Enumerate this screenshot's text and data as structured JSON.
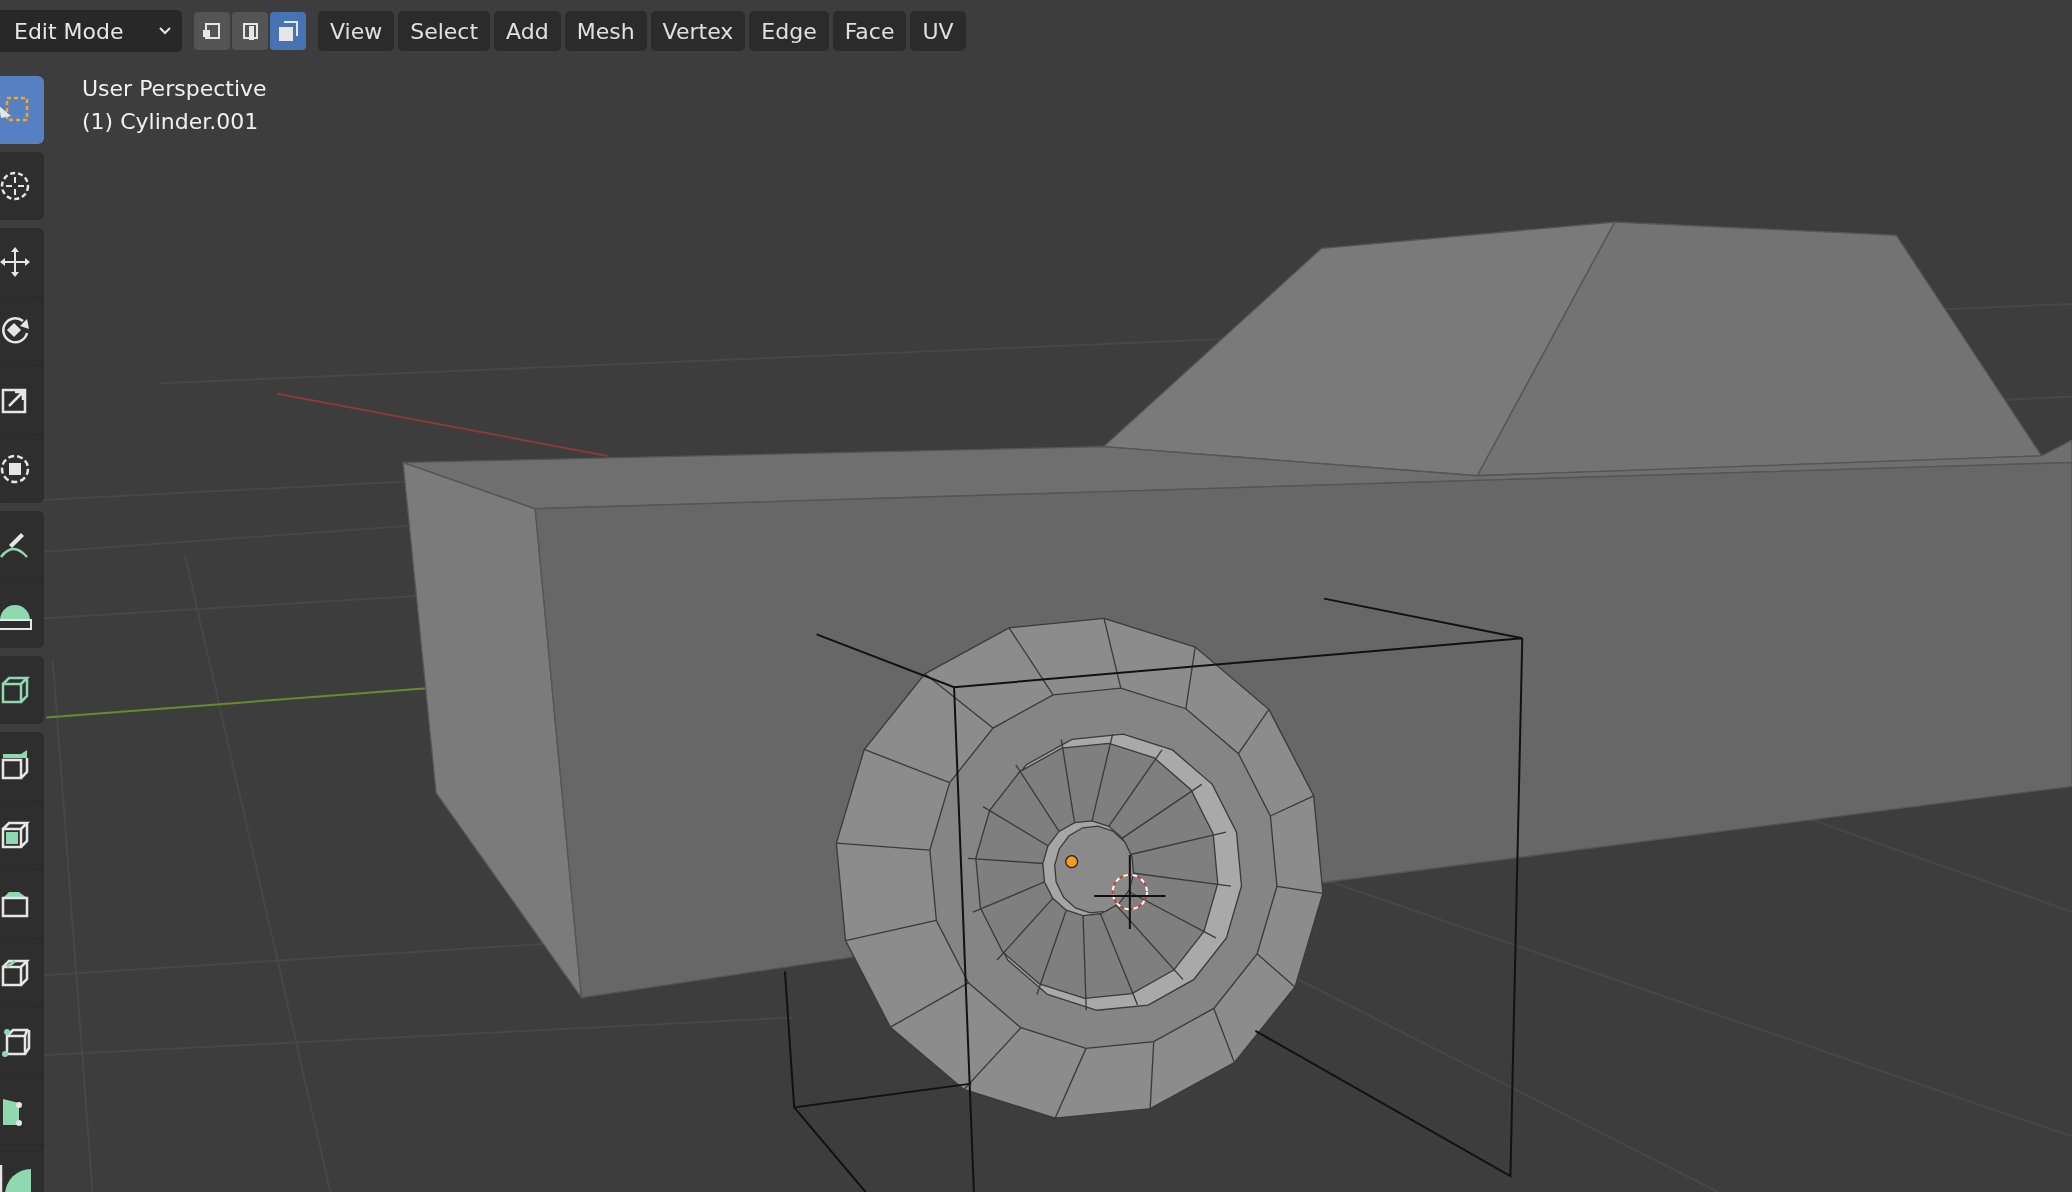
{
  "header": {
    "mode_dropdown": {
      "label": "Edit Mode"
    },
    "select_modes": [
      {
        "kind": "vertex",
        "selected": false
      },
      {
        "kind": "edge",
        "selected": false
      },
      {
        "kind": "face",
        "selected": true
      }
    ],
    "menus": [
      "View",
      "Select",
      "Add",
      "Mesh",
      "Vertex",
      "Edge",
      "Face",
      "UV"
    ]
  },
  "viewport_overlay": {
    "view_name": "User Perspective",
    "object_name": "(1) Cylinder.001"
  },
  "toolbar": {
    "groups": [
      [
        {
          "kind": "select_box",
          "selected": true
        }
      ],
      [
        {
          "kind": "cursor",
          "selected": false
        }
      ],
      [
        {
          "kind": "move",
          "selected": false
        },
        {
          "kind": "rotate",
          "selected": false
        },
        {
          "kind": "scale",
          "selected": false
        },
        {
          "kind": "transform",
          "selected": false
        }
      ],
      [
        {
          "kind": "annotate",
          "selected": false
        },
        {
          "kind": "measure",
          "selected": false
        }
      ],
      [
        {
          "kind": "add_cube",
          "selected": false
        }
      ],
      [
        {
          "kind": "extrude",
          "selected": false
        },
        {
          "kind": "inset",
          "selected": false
        },
        {
          "kind": "bevel",
          "selected": false
        },
        {
          "kind": "loop_cut",
          "selected": false
        },
        {
          "kind": "knife",
          "selected": false
        },
        {
          "kind": "poly_build",
          "selected": false
        },
        {
          "kind": "spin",
          "selected": false
        }
      ]
    ]
  }
}
